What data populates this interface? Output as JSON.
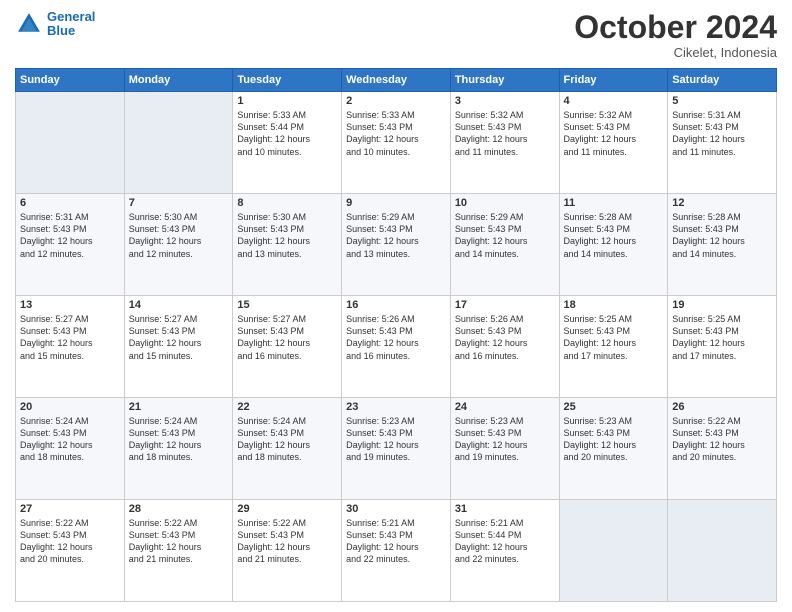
{
  "header": {
    "logo_line1": "General",
    "logo_line2": "Blue",
    "month": "October 2024",
    "location": "Cikelet, Indonesia"
  },
  "weekdays": [
    "Sunday",
    "Monday",
    "Tuesday",
    "Wednesday",
    "Thursday",
    "Friday",
    "Saturday"
  ],
  "weeks": [
    [
      {
        "day": "",
        "info": ""
      },
      {
        "day": "",
        "info": ""
      },
      {
        "day": "1",
        "info": "Sunrise: 5:33 AM\nSunset: 5:44 PM\nDaylight: 12 hours\nand 10 minutes."
      },
      {
        "day": "2",
        "info": "Sunrise: 5:33 AM\nSunset: 5:43 PM\nDaylight: 12 hours\nand 10 minutes."
      },
      {
        "day": "3",
        "info": "Sunrise: 5:32 AM\nSunset: 5:43 PM\nDaylight: 12 hours\nand 11 minutes."
      },
      {
        "day": "4",
        "info": "Sunrise: 5:32 AM\nSunset: 5:43 PM\nDaylight: 12 hours\nand 11 minutes."
      },
      {
        "day": "5",
        "info": "Sunrise: 5:31 AM\nSunset: 5:43 PM\nDaylight: 12 hours\nand 11 minutes."
      }
    ],
    [
      {
        "day": "6",
        "info": "Sunrise: 5:31 AM\nSunset: 5:43 PM\nDaylight: 12 hours\nand 12 minutes."
      },
      {
        "day": "7",
        "info": "Sunrise: 5:30 AM\nSunset: 5:43 PM\nDaylight: 12 hours\nand 12 minutes."
      },
      {
        "day": "8",
        "info": "Sunrise: 5:30 AM\nSunset: 5:43 PM\nDaylight: 12 hours\nand 13 minutes."
      },
      {
        "day": "9",
        "info": "Sunrise: 5:29 AM\nSunset: 5:43 PM\nDaylight: 12 hours\nand 13 minutes."
      },
      {
        "day": "10",
        "info": "Sunrise: 5:29 AM\nSunset: 5:43 PM\nDaylight: 12 hours\nand 14 minutes."
      },
      {
        "day": "11",
        "info": "Sunrise: 5:28 AM\nSunset: 5:43 PM\nDaylight: 12 hours\nand 14 minutes."
      },
      {
        "day": "12",
        "info": "Sunrise: 5:28 AM\nSunset: 5:43 PM\nDaylight: 12 hours\nand 14 minutes."
      }
    ],
    [
      {
        "day": "13",
        "info": "Sunrise: 5:27 AM\nSunset: 5:43 PM\nDaylight: 12 hours\nand 15 minutes."
      },
      {
        "day": "14",
        "info": "Sunrise: 5:27 AM\nSunset: 5:43 PM\nDaylight: 12 hours\nand 15 minutes."
      },
      {
        "day": "15",
        "info": "Sunrise: 5:27 AM\nSunset: 5:43 PM\nDaylight: 12 hours\nand 16 minutes."
      },
      {
        "day": "16",
        "info": "Sunrise: 5:26 AM\nSunset: 5:43 PM\nDaylight: 12 hours\nand 16 minutes."
      },
      {
        "day": "17",
        "info": "Sunrise: 5:26 AM\nSunset: 5:43 PM\nDaylight: 12 hours\nand 16 minutes."
      },
      {
        "day": "18",
        "info": "Sunrise: 5:25 AM\nSunset: 5:43 PM\nDaylight: 12 hours\nand 17 minutes."
      },
      {
        "day": "19",
        "info": "Sunrise: 5:25 AM\nSunset: 5:43 PM\nDaylight: 12 hours\nand 17 minutes."
      }
    ],
    [
      {
        "day": "20",
        "info": "Sunrise: 5:24 AM\nSunset: 5:43 PM\nDaylight: 12 hours\nand 18 minutes."
      },
      {
        "day": "21",
        "info": "Sunrise: 5:24 AM\nSunset: 5:43 PM\nDaylight: 12 hours\nand 18 minutes."
      },
      {
        "day": "22",
        "info": "Sunrise: 5:24 AM\nSunset: 5:43 PM\nDaylight: 12 hours\nand 18 minutes."
      },
      {
        "day": "23",
        "info": "Sunrise: 5:23 AM\nSunset: 5:43 PM\nDaylight: 12 hours\nand 19 minutes."
      },
      {
        "day": "24",
        "info": "Sunrise: 5:23 AM\nSunset: 5:43 PM\nDaylight: 12 hours\nand 19 minutes."
      },
      {
        "day": "25",
        "info": "Sunrise: 5:23 AM\nSunset: 5:43 PM\nDaylight: 12 hours\nand 20 minutes."
      },
      {
        "day": "26",
        "info": "Sunrise: 5:22 AM\nSunset: 5:43 PM\nDaylight: 12 hours\nand 20 minutes."
      }
    ],
    [
      {
        "day": "27",
        "info": "Sunrise: 5:22 AM\nSunset: 5:43 PM\nDaylight: 12 hours\nand 20 minutes."
      },
      {
        "day": "28",
        "info": "Sunrise: 5:22 AM\nSunset: 5:43 PM\nDaylight: 12 hours\nand 21 minutes."
      },
      {
        "day": "29",
        "info": "Sunrise: 5:22 AM\nSunset: 5:43 PM\nDaylight: 12 hours\nand 21 minutes."
      },
      {
        "day": "30",
        "info": "Sunrise: 5:21 AM\nSunset: 5:43 PM\nDaylight: 12 hours\nand 22 minutes."
      },
      {
        "day": "31",
        "info": "Sunrise: 5:21 AM\nSunset: 5:44 PM\nDaylight: 12 hours\nand 22 minutes."
      },
      {
        "day": "",
        "info": ""
      },
      {
        "day": "",
        "info": ""
      }
    ]
  ]
}
